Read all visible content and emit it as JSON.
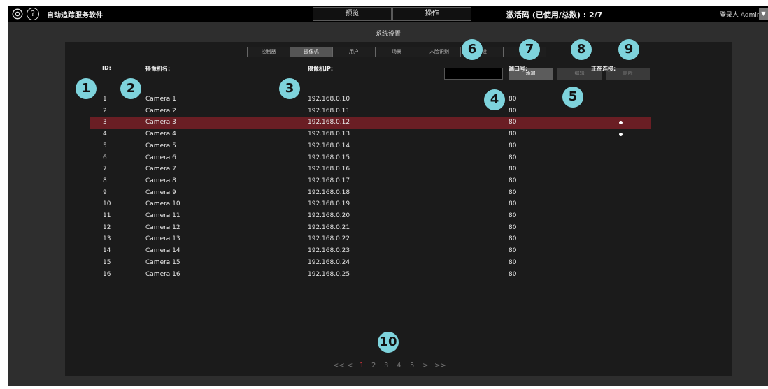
{
  "topbar": {
    "app_title": "自动追踪服务软件",
    "tabs": [
      "预览",
      "操作"
    ],
    "license_text": "激活码 (已使用/总数) : 2/7",
    "user_label": "登录人 Admin"
  },
  "window": {
    "title": "系统设置"
  },
  "subtabs": [
    "控制器",
    "摄像机",
    "用户",
    "场景",
    "人脸识别",
    "预设",
    ""
  ],
  "toolbar": {
    "add_label": "添加",
    "edit_label": "编辑",
    "delete_label": "删除"
  },
  "columns": {
    "id": "ID:",
    "name": "摄像机名:",
    "ip": "摄像机IP:",
    "port": "端口号:",
    "connecting": "正在连接:"
  },
  "rows": [
    {
      "id": "1",
      "name": "Camera 1",
      "ip": "192.168.0.10",
      "port": "80",
      "connecting": false,
      "selected": false
    },
    {
      "id": "2",
      "name": "Camera 2",
      "ip": "192.168.0.11",
      "port": "80",
      "connecting": false,
      "selected": false
    },
    {
      "id": "3",
      "name": "Camera 3",
      "ip": "192.168.0.12",
      "port": "80",
      "connecting": true,
      "selected": true
    },
    {
      "id": "4",
      "name": "Camera 4",
      "ip": "192.168.0.13",
      "port": "80",
      "connecting": true,
      "selected": false
    },
    {
      "id": "5",
      "name": "Camera 5",
      "ip": "192.168.0.14",
      "port": "80",
      "connecting": false,
      "selected": false
    },
    {
      "id": "6",
      "name": "Camera 6",
      "ip": "192.168.0.15",
      "port": "80",
      "connecting": false,
      "selected": false
    },
    {
      "id": "7",
      "name": "Camera 7",
      "ip": "192.168.0.16",
      "port": "80",
      "connecting": false,
      "selected": false
    },
    {
      "id": "8",
      "name": "Camera 8",
      "ip": "192.168.0.17",
      "port": "80",
      "connecting": false,
      "selected": false
    },
    {
      "id": "9",
      "name": "Camera 9",
      "ip": "192.168.0.18",
      "port": "80",
      "connecting": false,
      "selected": false
    },
    {
      "id": "10",
      "name": "Camera 10",
      "ip": "192.168.0.19",
      "port": "80",
      "connecting": false,
      "selected": false
    },
    {
      "id": "11",
      "name": "Camera 11",
      "ip": "192.168.0.20",
      "port": "80",
      "connecting": false,
      "selected": false
    },
    {
      "id": "12",
      "name": "Camera 12",
      "ip": "192.168.0.21",
      "port": "80",
      "connecting": false,
      "selected": false
    },
    {
      "id": "13",
      "name": "Camera 13",
      "ip": "192.168.0.22",
      "port": "80",
      "connecting": false,
      "selected": false
    },
    {
      "id": "14",
      "name": "Camera 14",
      "ip": "192.168.0.23",
      "port": "80",
      "connecting": false,
      "selected": false
    },
    {
      "id": "15",
      "name": "Camera 15",
      "ip": "192.168.0.24",
      "port": "80",
      "connecting": false,
      "selected": false
    },
    {
      "id": "16",
      "name": "Camera 16",
      "ip": "192.168.0.25",
      "port": "80",
      "connecting": false,
      "selected": false
    }
  ],
  "pagination": {
    "first": "<<",
    "prev": "<",
    "pages": [
      "1",
      "2",
      "3",
      "4",
      "5"
    ],
    "current": "1",
    "next": ">",
    "last": ">>"
  },
  "markers": [
    "1",
    "2",
    "3",
    "4",
    "5",
    "6",
    "7",
    "8",
    "9",
    "10"
  ],
  "colors": {
    "marker": "#7ed3dc",
    "selected_row": "#6a1e24",
    "current_page": "#c8323a"
  }
}
